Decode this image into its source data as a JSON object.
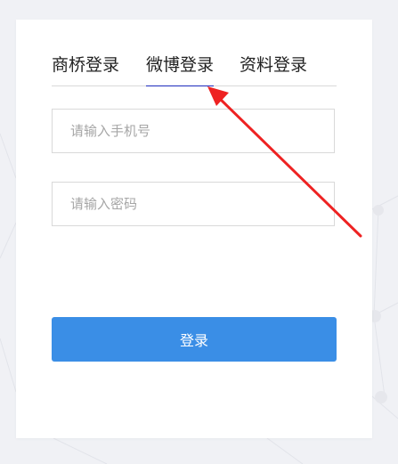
{
  "tabs": [
    {
      "label": "商桥登录",
      "active": false
    },
    {
      "label": "微博登录",
      "active": true
    },
    {
      "label": "资料登录",
      "active": false
    }
  ],
  "form": {
    "phone_placeholder": "请输入手机号",
    "phone_value": "",
    "password_placeholder": "请输入密码",
    "password_value": "",
    "login_label": "登录"
  },
  "colors": {
    "primary_button": "#3a8ee6",
    "active_tab_underline": "#1d2bbd",
    "annotation_arrow": "#ee2222"
  },
  "annotation": {
    "type": "arrow",
    "icon": "red-arrow-icon",
    "points_to": "tab-weibo-login"
  }
}
